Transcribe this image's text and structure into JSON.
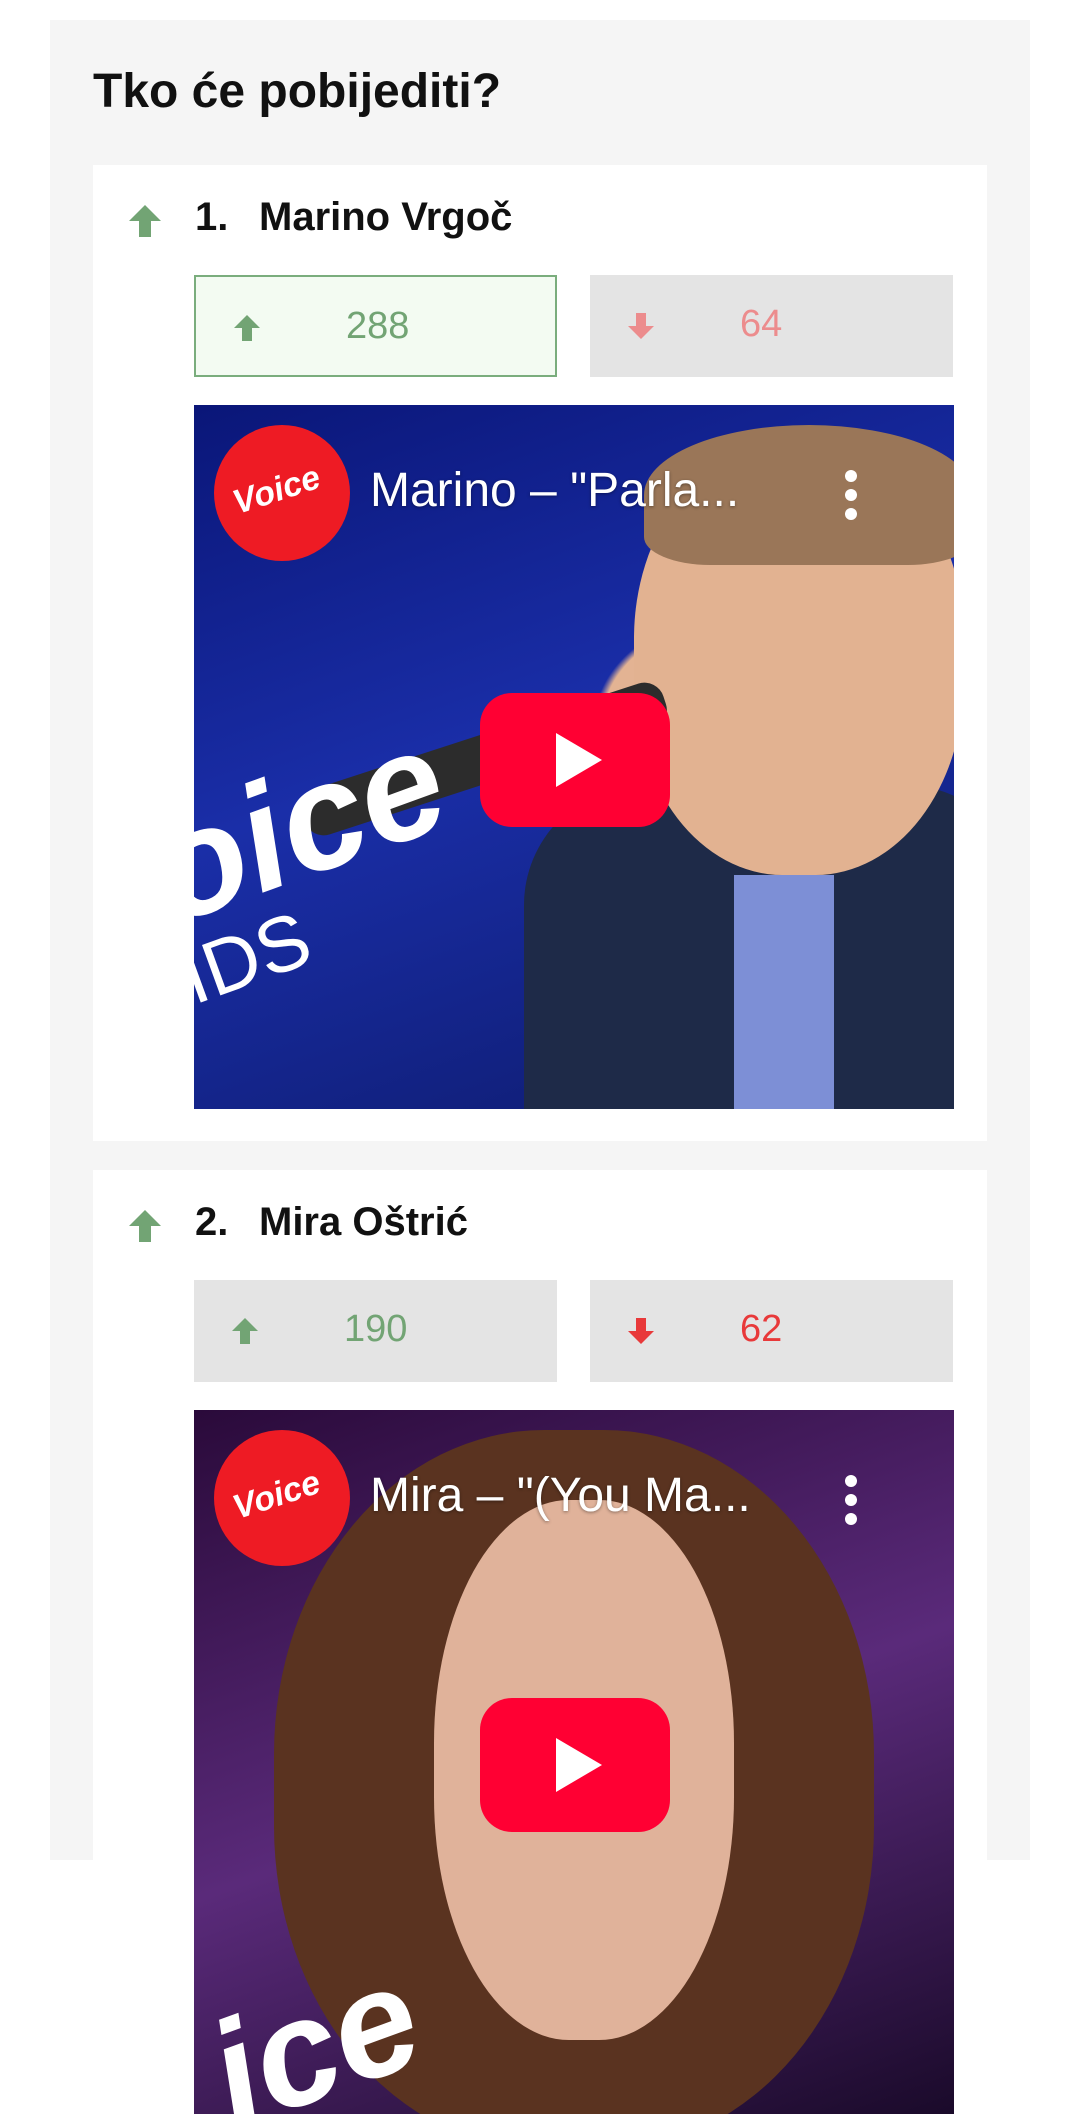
{
  "poll": {
    "title": "Tko će pobijediti?",
    "items": [
      {
        "rank": "1.",
        "name": "Marino Vrgoč",
        "upvotes": "288",
        "downvotes": "64",
        "video_title": "Marino – \"Parla...",
        "channel_logo_text": "Voice"
      },
      {
        "rank": "2.",
        "name": "Mira Oštrić",
        "upvotes": "190",
        "downvotes": "62",
        "video_title": "Mira – \"(You Ma...",
        "channel_logo_text": "Voice"
      }
    ]
  },
  "colors": {
    "upvote_green": "#72a474",
    "downvote_red": "#e8393a",
    "youtube_red": "#ff0033",
    "panel_background": "#f5f5f5"
  },
  "icons": [
    "arrow-up-icon",
    "arrow-down-icon",
    "youtube-play-icon",
    "more-vertical-icon"
  ]
}
